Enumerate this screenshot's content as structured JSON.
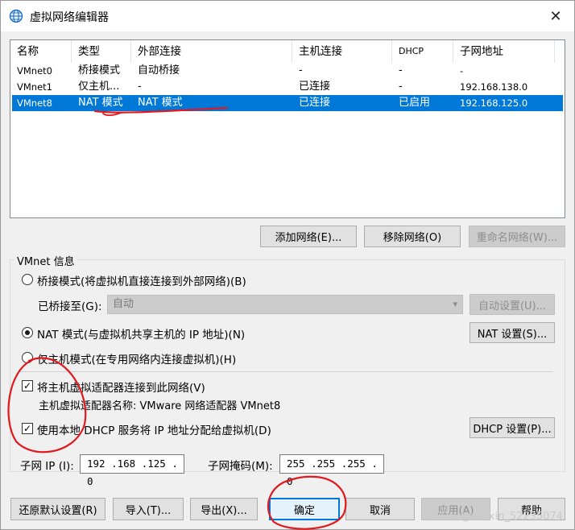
{
  "window": {
    "title": "虚拟网络编辑器",
    "close_glyph": "✕"
  },
  "network_list": {
    "columns": [
      "名称",
      "类型",
      "外部连接",
      "主机连接",
      "DHCP",
      "子网地址"
    ],
    "rows": [
      {
        "name": "VMnet0",
        "type": "桥接模式",
        "external": "自动桥接",
        "host": "-",
        "dhcp": "-",
        "subnet": "-",
        "selected": false
      },
      {
        "name": "VMnet1",
        "type": "仅主机...",
        "external": "-",
        "host": "已连接",
        "dhcp": "-",
        "subnet": "192.168.138.0",
        "selected": false
      },
      {
        "name": "VMnet8",
        "type": "NAT 模式",
        "external": "NAT 模式",
        "host": "已连接",
        "dhcp": "已启用",
        "subnet": "192.168.125.0",
        "selected": true
      }
    ]
  },
  "network_buttons": {
    "add": "添加网络(E)...",
    "remove": "移除网络(O)",
    "rename": "重命名网络(W)..."
  },
  "vmnet_info": {
    "group_label": "VMnet 信息",
    "bridged_radio": "桥接模式(将虚拟机直接连接到外部网络)(B)",
    "bridged_to_label": "已桥接至(G):",
    "bridged_to_value": "自动",
    "auto_settings": "自动设置(U)...",
    "nat_radio": "NAT 模式(与虚拟机共享主机的 IP 地址)(N)",
    "nat_settings": "NAT 设置(S)...",
    "hostonly_radio": "仅主机模式(在专用网络内连接虚拟机)(H)",
    "connect_adapter_check": "将主机虚拟适配器连接到此网络(V)",
    "adapter_name": "主机虚拟适配器名称: VMware 网络适配器 VMnet8",
    "dhcp_check": "使用本地 DHCP 服务将 IP 地址分配给虚拟机(D)",
    "dhcp_settings": "DHCP 设置(P)...",
    "subnet_ip_label": "子网 IP (I):",
    "subnet_ip_value": "192 .168 .125 .  0",
    "subnet_mask_label": "子网掩码(M):",
    "subnet_mask_value": "255 .255 .255 .  0",
    "mode_selected": "nat",
    "connect_adapter_checked": true,
    "dhcp_checked": true
  },
  "footer_buttons": {
    "restore": "还原默认设置(R)",
    "import": "导入(T)...",
    "export": "导出(X)...",
    "ok": "确定",
    "cancel": "取消",
    "apply": "应用(A)",
    "help": "帮助"
  },
  "watermark": "CSDN @weixin_52235074",
  "colors": {
    "selection": "#0078d7",
    "annotation": "#e0191e",
    "window_bg": "#f0f0f0"
  }
}
